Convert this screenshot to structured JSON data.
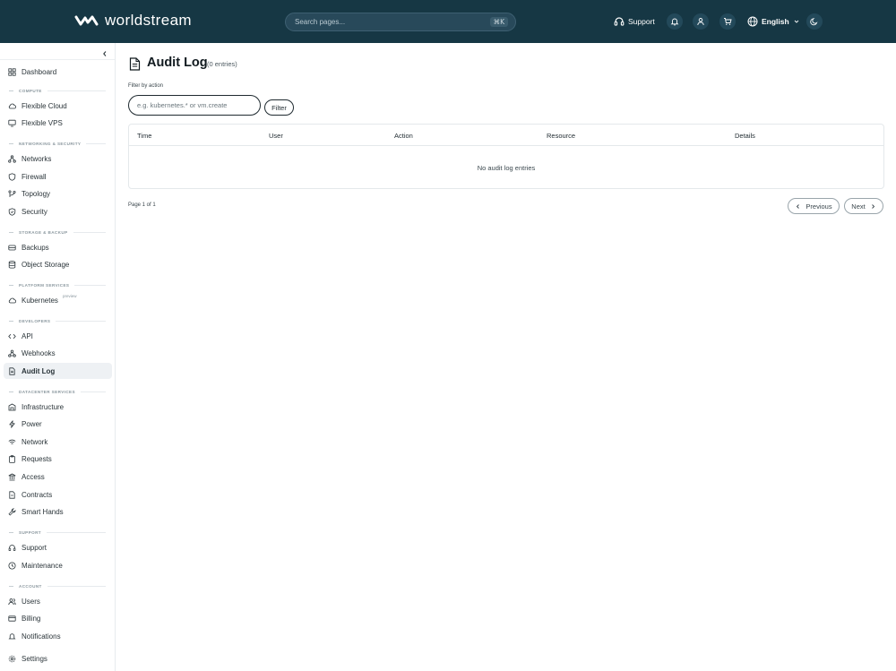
{
  "brand": {
    "name": "worldstream"
  },
  "header": {
    "search_placeholder": "Search pages...",
    "search_shortcut": "⌘K",
    "support_label": "Support",
    "language_label": "English",
    "icons": [
      "headset-icon",
      "bell-icon",
      "user-icon",
      "cart-icon",
      "globe-icon",
      "chevron-down-icon",
      "moon-icon"
    ]
  },
  "sidebar": {
    "top_item": {
      "label": "Dashboard",
      "icon": "dashboard-icon"
    },
    "sections": {
      "compute": "COMPUTE",
      "networking": "NETWORKING & SECURITY",
      "storage": "STORAGE & BACKUP",
      "platform": "PLATFORM SERVICES",
      "developers": "DEVELOPERS",
      "datacenter": "DATACENTER SERVICES",
      "support": "SUPPORT",
      "account": "ACCOUNT"
    },
    "items": {
      "flexible_cloud": "Flexible Cloud",
      "flexible_vps": "Flexible VPS",
      "networks": "Networks",
      "firewall": "Firewall",
      "topology": "Topology",
      "security": "Security",
      "backups": "Backups",
      "object_storage": "Object Storage",
      "kubernetes": "Kubernetes",
      "api": "API",
      "webhooks": "Webhooks",
      "audit_log": "Audit Log",
      "infrastructure": "Infrastructure",
      "power": "Power",
      "network": "Network",
      "requests": "Requests",
      "access": "Access",
      "contracts": "Contracts",
      "smart_hands": "Smart Hands",
      "support": "Support",
      "maintenance": "Maintenance",
      "users": "Users",
      "billing": "Billing",
      "notifications": "Notifications",
      "settings": "Settings"
    },
    "kubernetes_badge": "preview",
    "active_item": "Audit Log"
  },
  "main": {
    "title": "Audit Log",
    "entries_count": "(0 entries)",
    "filter_label": "Filter by action",
    "filter_placeholder": "e.g. kubernetes.* or vm.create",
    "filter_value": "",
    "filter_button": "Filter",
    "table": {
      "columns": [
        "Time",
        "User",
        "Action",
        "Resource",
        "Details"
      ],
      "rows": [],
      "empty_message": "No audit log entries"
    },
    "pagination": {
      "page_info": "Page 1 of 1",
      "previous": "Previous",
      "next": "Next"
    }
  },
  "colors": {
    "header_bg": "#163744",
    "active_item_bg": "#eef1f4"
  }
}
